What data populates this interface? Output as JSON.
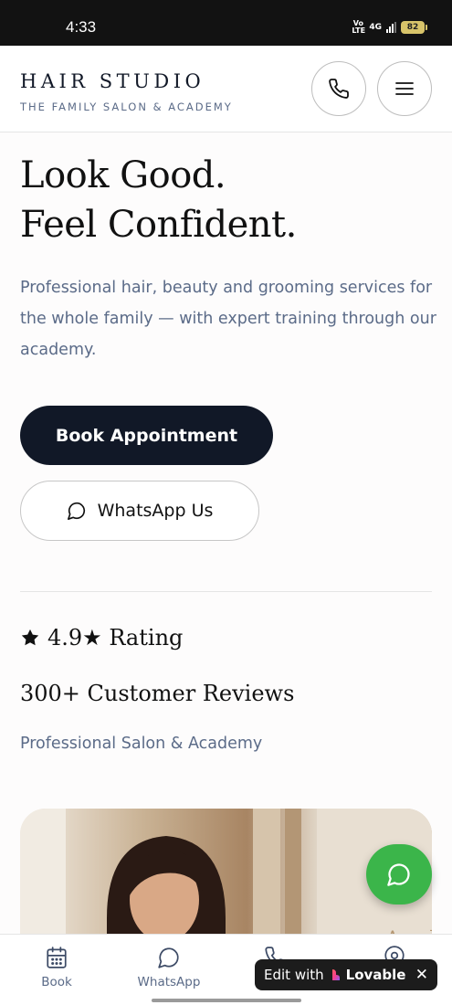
{
  "status_bar": {
    "time": "4:33",
    "volte": "Vo LTE",
    "network": "4G",
    "battery": "82"
  },
  "header": {
    "brand_name": "HAIR STUDIO",
    "tagline": "THE FAMILY SALON & ACADEMY",
    "call_icon": "phone-icon",
    "menu_icon": "hamburger-menu-icon"
  },
  "hero": {
    "title_line1": "Look Good.",
    "title_line2": "Feel Confident.",
    "description": "Professional hair, beauty and grooming services for the whole family — with expert training through our academy.",
    "book_button": "Book Appointment",
    "whatsapp_button": "WhatsApp Us"
  },
  "stats": {
    "rating": "4.9★ Rating",
    "reviews": "300+ Customer Reviews",
    "label": "Professional Salon & Academy"
  },
  "bottom_nav": {
    "items": [
      {
        "label": "Book",
        "icon": "calendar-icon"
      },
      {
        "label": "WhatsApp",
        "icon": "chat-bubble-icon"
      },
      {
        "label": "",
        "icon": "phone-icon"
      },
      {
        "label": "",
        "icon": "location-pin-icon"
      }
    ]
  },
  "lovable_badge": {
    "edit_text": "Edit with",
    "brand": "Lovable"
  },
  "colors": {
    "primary_dark": "#111827",
    "muted_text": "#5b6b88",
    "whatsapp_green": "#3bb54a"
  }
}
